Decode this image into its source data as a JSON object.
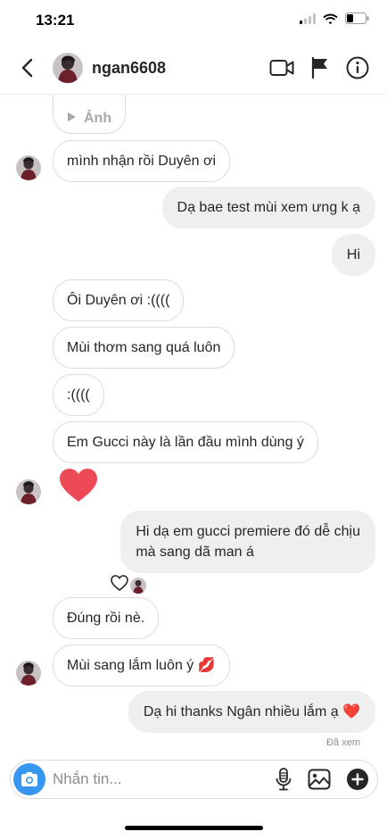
{
  "status_bar": {
    "time": "13:21"
  },
  "header": {
    "username": "ngan6608"
  },
  "photo_label": "Ảnh",
  "messages": [
    {
      "text": "mình nhận rồi Duyên ơi"
    },
    {
      "text": "Dạ bae test mùi xem ưng k ạ"
    },
    {
      "text": "Hi"
    },
    {
      "text": "Ôi Duyên ơi :(((("
    },
    {
      "text": "Mùi thơm sang quá luôn"
    },
    {
      "text": ":(((("
    },
    {
      "text": "Em Gucci này là lần đầu mình dùng ý"
    },
    {
      "text": "Hi dạ em gucci premiere đó dễ chịu"
    },
    {
      "text": "mà sang dã man á"
    },
    {
      "text": "Đúng rồi nè."
    },
    {
      "text": "Mùi sang lắm luôn ý 💋"
    },
    {
      "text": "Dạ hi thanks Ngân nhiều lắm ạ ❤️"
    }
  ],
  "seen_label": "Đã xem",
  "composer": {
    "placeholder": "Nhắn tin..."
  },
  "colors": {
    "accent": "#3797f0",
    "heart": "#ed4956",
    "incoming_border": "#dbdbdb",
    "outgoing_bg": "#efefef"
  }
}
